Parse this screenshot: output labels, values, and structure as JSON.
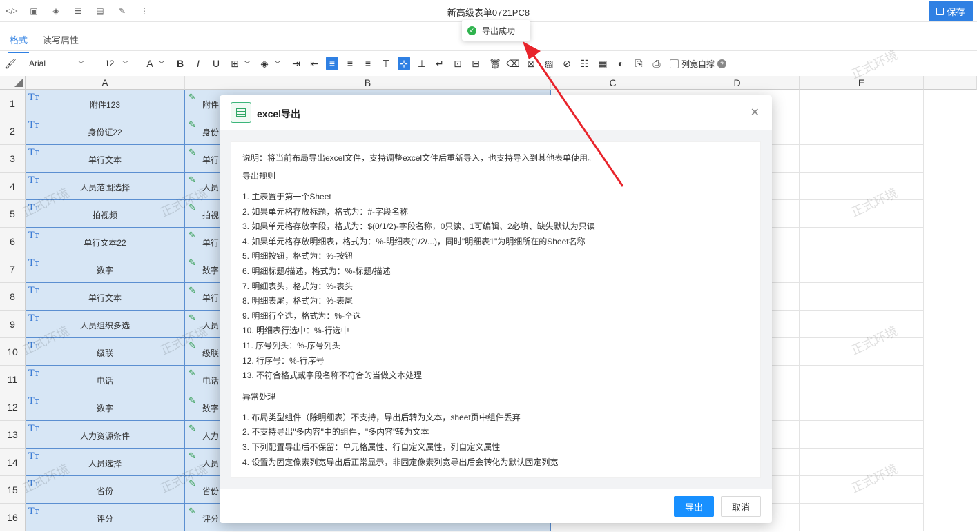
{
  "title": "新高级表单0721PC8",
  "save_label": "保存",
  "tabs": [
    "格式",
    "读写属性"
  ],
  "toolbar": {
    "font": "Arial",
    "size": "12",
    "colwidth_label": "列宽自撑"
  },
  "columns": [
    "A",
    "B",
    "C",
    "D",
    "E"
  ],
  "rows": [
    {
      "num": "1",
      "a": "附件123",
      "b": "附件"
    },
    {
      "num": "2",
      "a": "身份证22",
      "b": "身份"
    },
    {
      "num": "3",
      "a": "单行文本",
      "b": "单行"
    },
    {
      "num": "4",
      "a": "人员范围选择",
      "b": "人员"
    },
    {
      "num": "5",
      "a": "拍视频",
      "b": "拍视"
    },
    {
      "num": "6",
      "a": "单行文本22",
      "b": "单行"
    },
    {
      "num": "7",
      "a": "数字",
      "b": "数字"
    },
    {
      "num": "8",
      "a": "单行文本",
      "b": "单行"
    },
    {
      "num": "9",
      "a": "人员组织多选",
      "b": "人员"
    },
    {
      "num": "10",
      "a": "级联",
      "b": "级联"
    },
    {
      "num": "11",
      "a": "电话",
      "b": "电话"
    },
    {
      "num": "12",
      "a": "数字",
      "b": "数字"
    },
    {
      "num": "13",
      "a": "人力资源条件",
      "b": "人力"
    },
    {
      "num": "14",
      "a": "人员选择",
      "b": "人员"
    },
    {
      "num": "15",
      "a": "省份",
      "b": "省份"
    },
    {
      "num": "16",
      "a": "评分",
      "b": "评分"
    }
  ],
  "watermark": "正式环境",
  "toast": "导出成功",
  "modal": {
    "title": "excel导出",
    "description": "说明：将当前布局导出excel文件，支持调整excel文件后重新导入，也支持导入到其他表单使用。",
    "rules_title": "导出规则",
    "rules": [
      "1. 主表置于第一个Sheet",
      "2. 如果单元格存放标题，格式为：#-字段名称",
      "3. 如果单元格存放字段，格式为：$(0/1/2)-字段名称，0只读、1可编辑、2必填、缺失默认为只读",
      "4. 如果单元格存放明细表，格式为：%-明细表(1/2/...)，同时\"明细表1\"为明细所在的Sheet名称",
      "5. 明细按钮，格式为：%-按钮",
      "6. 明细标题/描述，格式为：%-标题/描述",
      "7. 明细表头，格式为：%-表头",
      "8. 明细表尾，格式为：%-表尾",
      "9. 明细行全选，格式为：%-全选",
      "10. 明细表行选中：%-行选中",
      "11. 序号列头：%-序号列头",
      "12. 行序号：%-行序号",
      "13. 不符合格式或字段名称不符合的当做文本处理"
    ],
    "exceptions_title": "异常处理",
    "exceptions": [
      "1. 布局类型组件（除明细表）不支持，导出后转为文本，sheet页中组件丢弃",
      "2. 不支持导出\"多内容\"中的组件，\"多内容\"转为文本",
      "3. 下列配置导出后不保留：单元格属性、行自定义属性，列自定义属性",
      "4. 设置为固定像素列宽导出后正常显示，非固定像素列宽导出后会转化为默认固定列宽"
    ],
    "export_label": "导出",
    "cancel_label": "取消"
  },
  "colors": {
    "accent": "#2f80e3",
    "selection": "#d7e6f5",
    "success": "#2fb34e",
    "arrow": "#e8242b"
  }
}
